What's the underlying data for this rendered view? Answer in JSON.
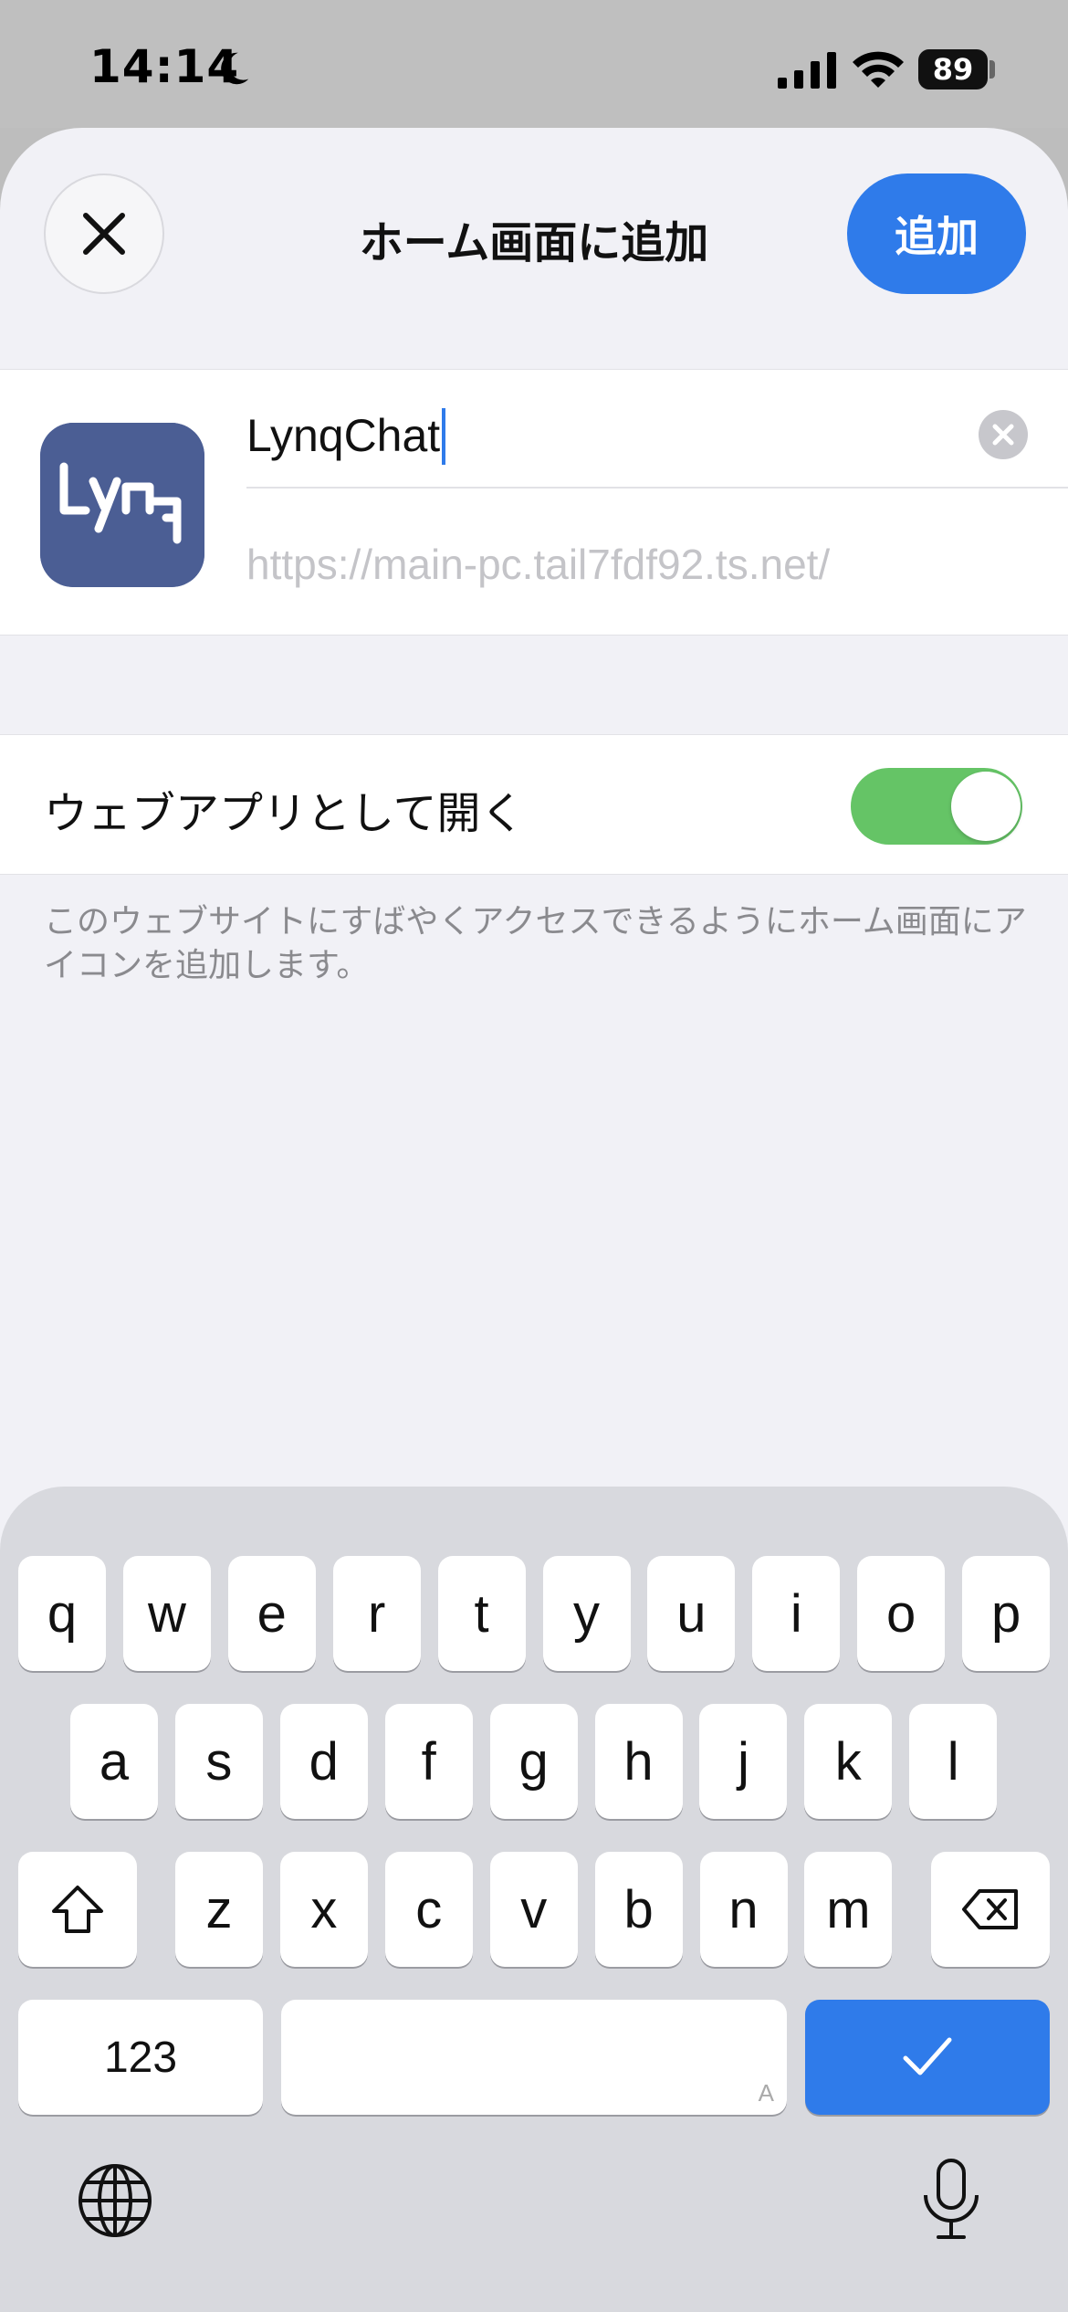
{
  "status_bar": {
    "time": "14:14",
    "battery": "89",
    "icons": [
      "moon-icon",
      "signal-icon",
      "wifi-icon",
      "battery-icon"
    ]
  },
  "header": {
    "title": "ホーム画面に追加",
    "add_label": "追加",
    "close_icon": "close-icon"
  },
  "app": {
    "name_value": "LynqChat",
    "url": "https://main-pc.tail7fdf92.ts.net/",
    "icon_text": "Lyrq"
  },
  "settings": {
    "open_as_web_app_label": "ウェブアプリとして開く",
    "open_as_web_app_on": true,
    "description": "このウェブサイトにすばやくアクセスできるようにホーム画面にアイコンを追加します。"
  },
  "keyboard": {
    "row1": [
      "q",
      "w",
      "e",
      "r",
      "t",
      "y",
      "u",
      "i",
      "o",
      "p"
    ],
    "row2": [
      "a",
      "s",
      "d",
      "f",
      "g",
      "h",
      "j",
      "k",
      "l"
    ],
    "row3": [
      "z",
      "x",
      "c",
      "v",
      "b",
      "n",
      "m"
    ],
    "numbers_label": "123",
    "space_hint": "A",
    "done_icon": "checkmark-icon"
  },
  "colors": {
    "accent": "#2f7bea",
    "toggle_on": "#65c466",
    "app_icon_bg": "#4b5e94"
  }
}
